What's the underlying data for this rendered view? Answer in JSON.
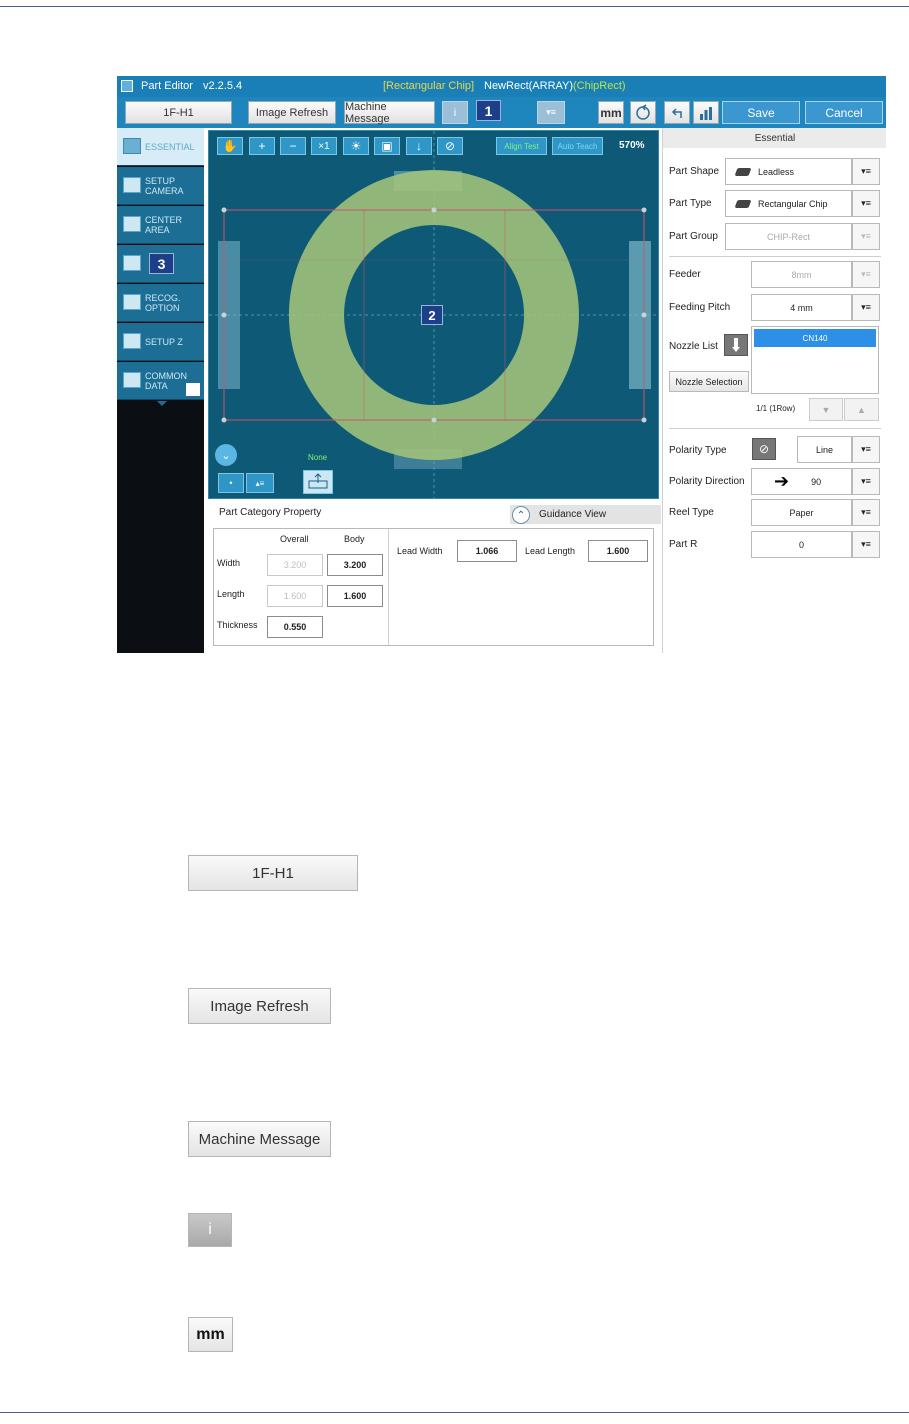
{
  "titlebar": {
    "app_title": "Part Editor",
    "version": "v2.2.5.4",
    "category": "[Rectangular Chip]",
    "part_name": "NewRect(ARRAY)",
    "part_type": "(ChipRect)"
  },
  "toolbar": {
    "head": "1F-H1",
    "image_refresh": "Image Refresh",
    "machine_message": "Machine Message",
    "info": "i",
    "badge": "1",
    "list": "▾≡",
    "unit": "mm",
    "save": "Save",
    "cancel": "Cancel"
  },
  "nav": {
    "items": [
      {
        "label": "ESSENTIAL",
        "icon": "check-icon"
      },
      {
        "label": "SETUP\nCAMERA",
        "icon": "camera-icon"
      },
      {
        "label": "CENTER\nAREA",
        "icon": "target-icon"
      },
      {
        "label": "",
        "icon": "image-icon"
      },
      {
        "label": "RECOG.\nOPTION",
        "icon": "recog-icon"
      },
      {
        "label": "SETUP Z",
        "icon": "z-axis-icon"
      },
      {
        "label": "COMMON\nDATA",
        "icon": "data-icon"
      }
    ],
    "badge": "3"
  },
  "view": {
    "tools": [
      "✋",
      "+",
      "−",
      "×1",
      "☀",
      "▣",
      "↓",
      "⊘"
    ],
    "align_test": "Align Test",
    "auto_teach": "Auto Teach",
    "zoom": "570%",
    "badge": "2",
    "none_label": "None",
    "dot_btn": "•",
    "list_btn": "▴≡",
    "colors": {
      "bg": "#0e5a76",
      "ring": "#a3c47a",
      "box": "#d0506a"
    }
  },
  "prop": {
    "title": "Part Category Property",
    "guidance": "Guidance View",
    "col_overall": "Overall",
    "col_body": "Body",
    "width_label": "Width",
    "length_label": "Length",
    "thickness_label": "Thickness",
    "width_overall": "3.200",
    "width_body": "3.200",
    "length_overall": "1.600",
    "length_body": "1.600",
    "thickness": "0.550",
    "lead_width_label": "Lead Width",
    "lead_width": "1.066",
    "lead_length_label": "Lead Length",
    "lead_length": "1.600"
  },
  "right": {
    "header": "Essential",
    "part_shape_label": "Part Shape",
    "part_shape": "Leadless",
    "part_type_label": "Part Type",
    "part_type": "Rectangular Chip",
    "part_group_label": "Part Group",
    "part_group": "CHIP-Rect",
    "feeder_label": "Feeder",
    "feeder": "8mm",
    "feeding_pitch_label": "Feeding Pitch",
    "feeding_pitch": "4 mm",
    "nozzle_list_label": "Nozzle List",
    "nozzle_item": "CN140",
    "nozzle_selection": "Nozzle Selection",
    "nozzle_page": "1/1 (1Row)",
    "polarity_type_label": "Polarity Type",
    "polarity_type": "Line",
    "polarity_direction_label": "Polarity Direction",
    "polarity_direction": "90",
    "reel_type_label": "Reel Type",
    "reel_type": "Paper",
    "part_r_label": "Part R",
    "part_r": "0",
    "drop": "▾≡"
  },
  "detail_buttons": {
    "head": "1F-H1",
    "image_refresh": "Image Refresh",
    "machine_message": "Machine Message",
    "info": "i",
    "unit": "mm"
  }
}
